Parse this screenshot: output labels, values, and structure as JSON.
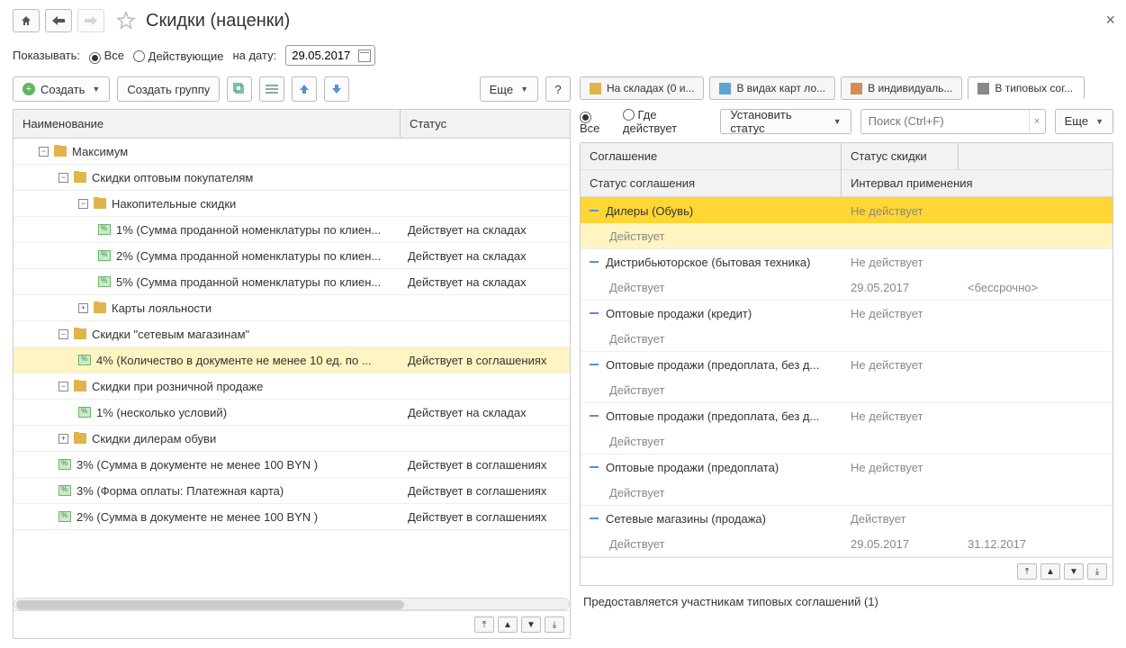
{
  "title": "Скидки (наценки)",
  "filter": {
    "show_label": "Показывать:",
    "all": "Все",
    "active": "Действующие",
    "on_date": "на дату:",
    "date": "29.05.2017"
  },
  "toolbar": {
    "create": "Создать",
    "create_group": "Создать группу",
    "more": "Еще",
    "help": "?"
  },
  "columns": {
    "name": "Наименование",
    "status": "Статус"
  },
  "tree": [
    {
      "lvl": 0,
      "type": "folder",
      "exp": "-",
      "label": "Максимум",
      "status": ""
    },
    {
      "lvl": 1,
      "type": "folder",
      "exp": "-",
      "label": "Скидки оптовым покупателям",
      "status": ""
    },
    {
      "lvl": 2,
      "type": "folder",
      "exp": "-",
      "label": "Накопительные скидки",
      "status": ""
    },
    {
      "lvl": 3,
      "type": "leaf",
      "label": "1% (Сумма проданной номенклатуры по клиен...",
      "status": "Действует на складах"
    },
    {
      "lvl": 3,
      "type": "leaf",
      "label": "2% (Сумма проданной номенклатуры по клиен...",
      "status": "Действует на складах"
    },
    {
      "lvl": 3,
      "type": "leaf",
      "label": "5% (Сумма проданной номенклатуры по клиен...",
      "status": "Действует на складах"
    },
    {
      "lvl": 2,
      "type": "folder",
      "exp": "+",
      "label": "Карты лояльности",
      "status": ""
    },
    {
      "lvl": 1,
      "type": "folder",
      "exp": "-",
      "label": "Скидки \"сетевым магазинам\"",
      "status": ""
    },
    {
      "lvl": 2,
      "type": "leaf",
      "sel": true,
      "label": "4% (Количество в документе не менее 10 ед. по ...",
      "status": "Действует в соглашениях"
    },
    {
      "lvl": 1,
      "type": "folder",
      "exp": "-",
      "label": "Скидки при розничной продаже",
      "status": ""
    },
    {
      "lvl": 2,
      "type": "leaf",
      "label": "1% (несколько условий)",
      "status": "Действует на складах"
    },
    {
      "lvl": 1,
      "type": "folder",
      "exp": "+",
      "label": "Скидки дилерам обуви",
      "status": ""
    },
    {
      "lvl": 1,
      "type": "leaf",
      "label": "3% (Сумма в документе не менее 100 BYN )",
      "status": "Действует в соглашениях"
    },
    {
      "lvl": 1,
      "type": "leaf",
      "label": "3% (Форма оплаты: Платежная карта)",
      "status": "Действует в соглашениях"
    },
    {
      "lvl": 1,
      "type": "leaf",
      "label": "2% (Сумма в документе не менее 100 BYN )",
      "status": "Действует в соглашениях"
    }
  ],
  "tabs": {
    "t1": "На складах (0 и...",
    "t2": "В видах карт ло...",
    "t3": "В индивидуаль...",
    "t4": "В типовых сог..."
  },
  "right_filter": {
    "all": "Все",
    "where": "Где действует",
    "set_status": "Установить статус",
    "search_ph": "Поиск (Ctrl+F)",
    "more": "Еще"
  },
  "rcols": {
    "agreement": "Соглашение",
    "discount_status": "Статус скидки",
    "agreement_status": "Статус соглашения",
    "interval": "Интервал применения"
  },
  "rrows": [
    {
      "sel": true,
      "name": "Дилеры (Обувь)",
      "dstatus": "Не действует",
      "astatus": "Действует",
      "from": "",
      "to": ""
    },
    {
      "name": "Дистрибьюторское (бытовая техника)",
      "dstatus": "Не действует",
      "astatus": "Действует",
      "from": "29.05.2017",
      "to": "<бессрочно>"
    },
    {
      "name": "Оптовые продажи (кредит)",
      "dstatus": "Не действует",
      "astatus": "Действует",
      "from": "",
      "to": ""
    },
    {
      "name": "Оптовые продажи (предоплата, без д...",
      "dstatus": "Не действует",
      "astatus": "Действует",
      "from": "",
      "to": ""
    },
    {
      "name": "Оптовые продажи (предоплата, без д...",
      "dstatus": "Не действует",
      "astatus": "Действует",
      "from": "",
      "to": ""
    },
    {
      "name": "Оптовые продажи (предоплата)",
      "dstatus": "Не действует",
      "astatus": "Действует",
      "from": "",
      "to": ""
    },
    {
      "name": "Сетевые магазины (продажа)",
      "dstatus": "Действует",
      "astatus": "Действует",
      "from": "29.05.2017",
      "to": "31.12.2017"
    }
  ],
  "footer_note": "Предоставляется участникам типовых соглашений (1)"
}
